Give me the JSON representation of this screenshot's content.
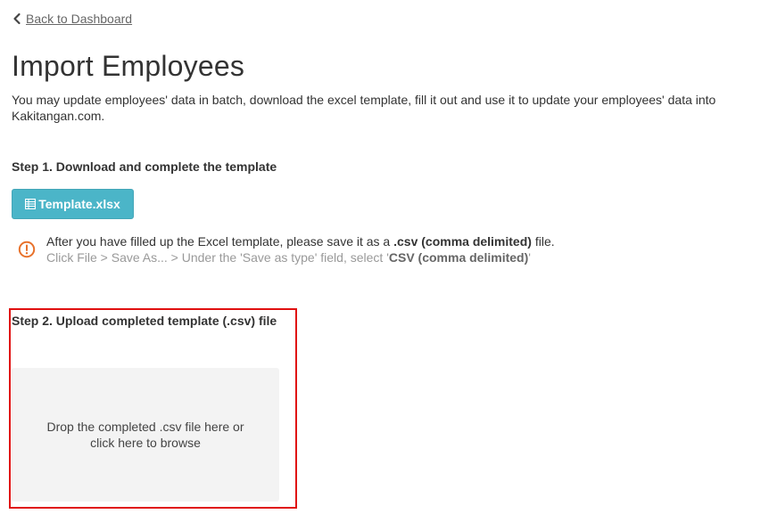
{
  "nav": {
    "back_label": "Back to Dashboard"
  },
  "header": {
    "title": "Import Employees",
    "intro": "You may update employees' data in batch, download the excel template, fill it out and use it to update your employees' data into Kakitangan.com."
  },
  "step1": {
    "title": "Step 1. Download and complete the template",
    "button_label": "Template.xlsx",
    "button_icon": "spreadsheet-icon",
    "notice_icon": "warning-circle-icon",
    "notice_line1_pre": "After you have filled up the Excel template, please save it as a ",
    "notice_line1_bold": ".csv (comma delimited)",
    "notice_line1_post": " file.",
    "notice_line2_pre": "Click File > Save As... > Under the 'Save as type' field, select '",
    "notice_line2_bold": "CSV (comma delimited)",
    "notice_line2_post": "'"
  },
  "step2": {
    "title": "Step 2. Upload completed template (.csv) file",
    "dropzone_text": "Drop the completed .csv file here or click here to browse"
  },
  "colors": {
    "button_bg": "#4bb5c8",
    "warning": "#e8722c",
    "highlight_border": "#e01010",
    "dropzone_bg": "#f3f3f3"
  }
}
